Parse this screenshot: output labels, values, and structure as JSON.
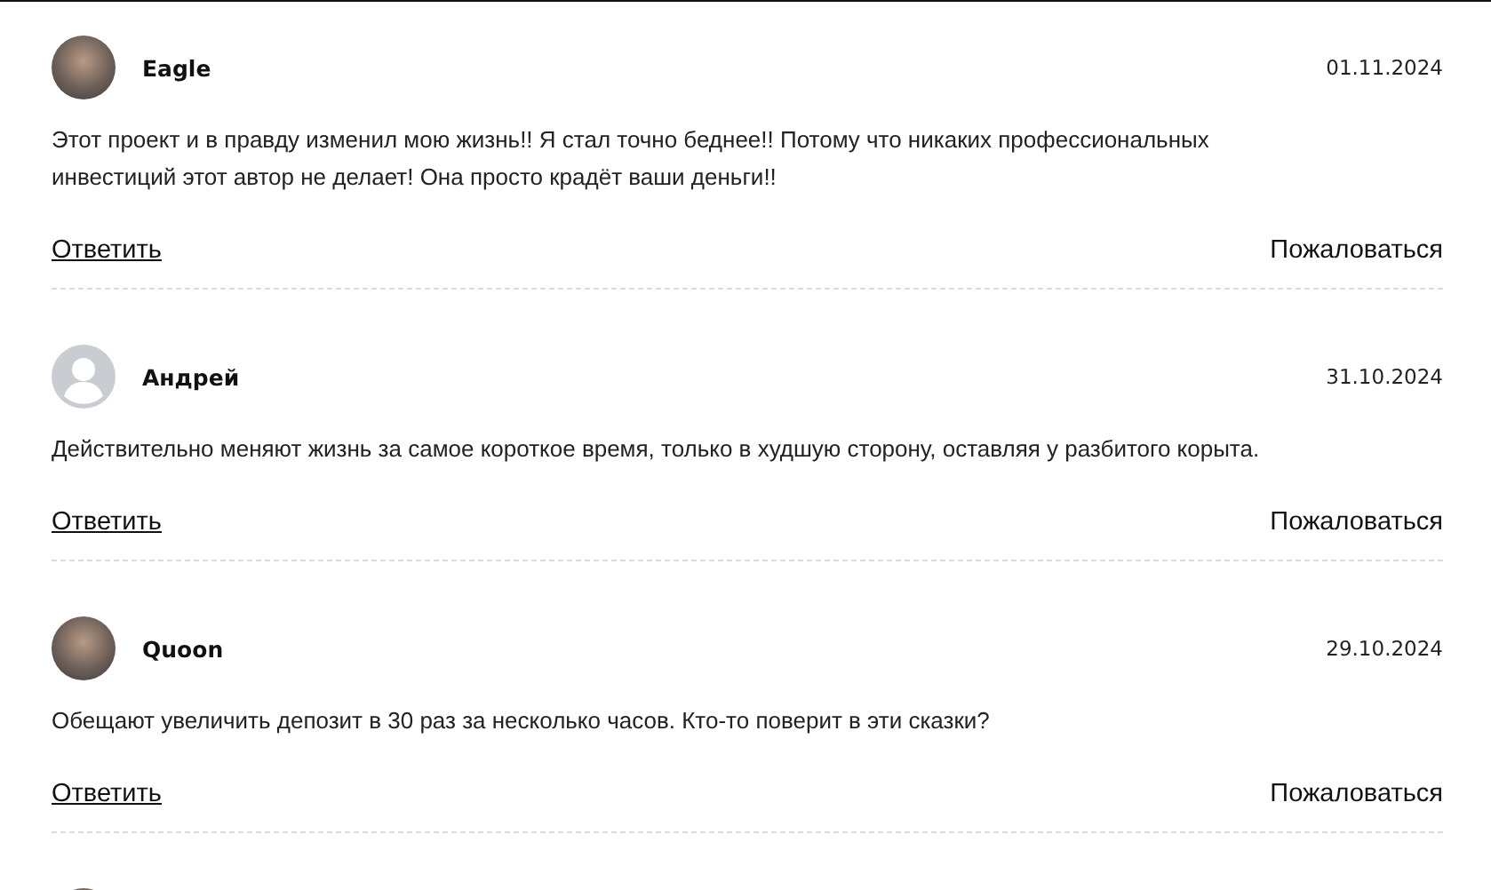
{
  "comments": [
    {
      "avatar": {
        "kind": "photo"
      },
      "author": "Eagle",
      "date": "01.11.2024",
      "text": "Этот проект и в правду изменил мою жизнь!! Я стал точно беднее!! Потому что никаких профессиональных инвестиций этот автор не делает! Она просто крадёт ваши деньги!!",
      "reply": "Ответить",
      "report": "Пожаловаться"
    },
    {
      "avatar": {
        "kind": "default"
      },
      "author": "Андрей",
      "date": "31.10.2024",
      "text": "Действительно меняют жизнь за самое короткое время, только в худшую сторону, оставляя у разбитого корыта.",
      "reply": "Ответить",
      "report": "Пожаловаться"
    },
    {
      "avatar": {
        "kind": "photo"
      },
      "author": "Quoon",
      "date": "29.10.2024",
      "text": "Обещают увеличить депозит в 30 раз за несколько часов. Кто-то поверит в эти сказки?",
      "reply": "Ответить",
      "report": "Пожаловаться"
    },
    {
      "avatar": {
        "kind": "photo"
      }
    }
  ]
}
